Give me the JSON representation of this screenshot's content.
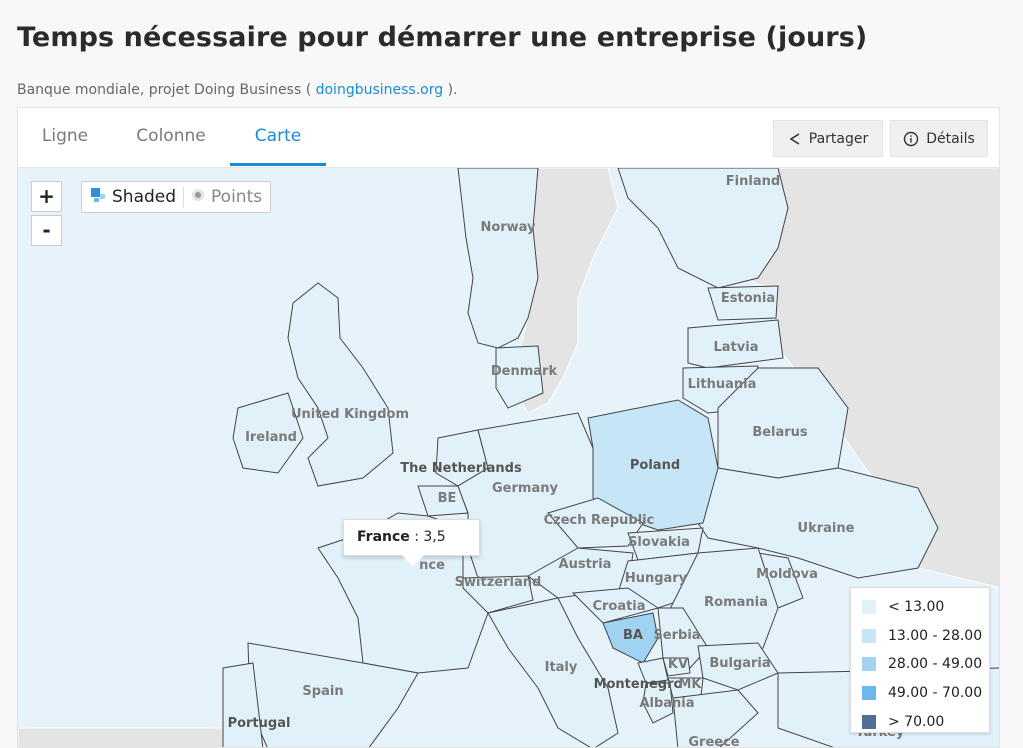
{
  "title": "Temps nécessaire pour démarrer une entreprise (jours)",
  "source": {
    "prefix": "Banque mondiale, projet Doing Business (",
    "link": "doingbusiness.org",
    "suffix": ")."
  },
  "tabs": [
    {
      "label": "Ligne",
      "active": false
    },
    {
      "label": "Colonne",
      "active": false
    },
    {
      "label": "Carte",
      "active": true
    }
  ],
  "buttons": {
    "share": "Partager",
    "details": "Détails"
  },
  "zoom": {
    "in": "+",
    "out": "-"
  },
  "mode": {
    "shaded": "Shaded",
    "points": "Points"
  },
  "legend": [
    {
      "label": "< 13.00",
      "color": "#e1f1fa"
    },
    {
      "label": "13.00 - 28.00",
      "color": "#c6e6f8"
    },
    {
      "label": "28.00 - 49.00",
      "color": "#9fd3f1"
    },
    {
      "label": "49.00 - 70.00",
      "color": "#6bb9ec"
    },
    {
      "label": "> 70.00",
      "color": "#4f6f95"
    }
  ],
  "tooltip": {
    "country": "France",
    "value": ": 3,5"
  },
  "countries": {
    "finland": "Finland",
    "norway": "Norway",
    "estonia": "Estonia",
    "latvia": "Latvia",
    "lithuania": "Lithuania",
    "denmark": "Denmark",
    "uk": "United Kingdom",
    "ireland": "Ireland",
    "belarus": "Belarus",
    "poland": "Poland",
    "netherlands": "The Netherlands",
    "germany": "Germany",
    "belgium": "BE",
    "czech": "Czech Republic",
    "slovakia": "Slovakia",
    "ukraine": "Ukraine",
    "france_tail": "nce",
    "austria": "Austria",
    "hungary": "Hungary",
    "moldova": "Moldova",
    "switzerland": "Switzerland",
    "romania": "Romania",
    "croatia": "Croatia",
    "bosnia": "BA",
    "serbia": "Serbia",
    "italy": "Italy",
    "kosovo": "KV",
    "bulgaria": "Bulgaria",
    "montenegro": "Montenegro",
    "macedonia": "MK",
    "spain": "Spain",
    "albania": "Albania",
    "portugal": "Portugal",
    "greece": "Greece",
    "turkey": "Turkey"
  }
}
